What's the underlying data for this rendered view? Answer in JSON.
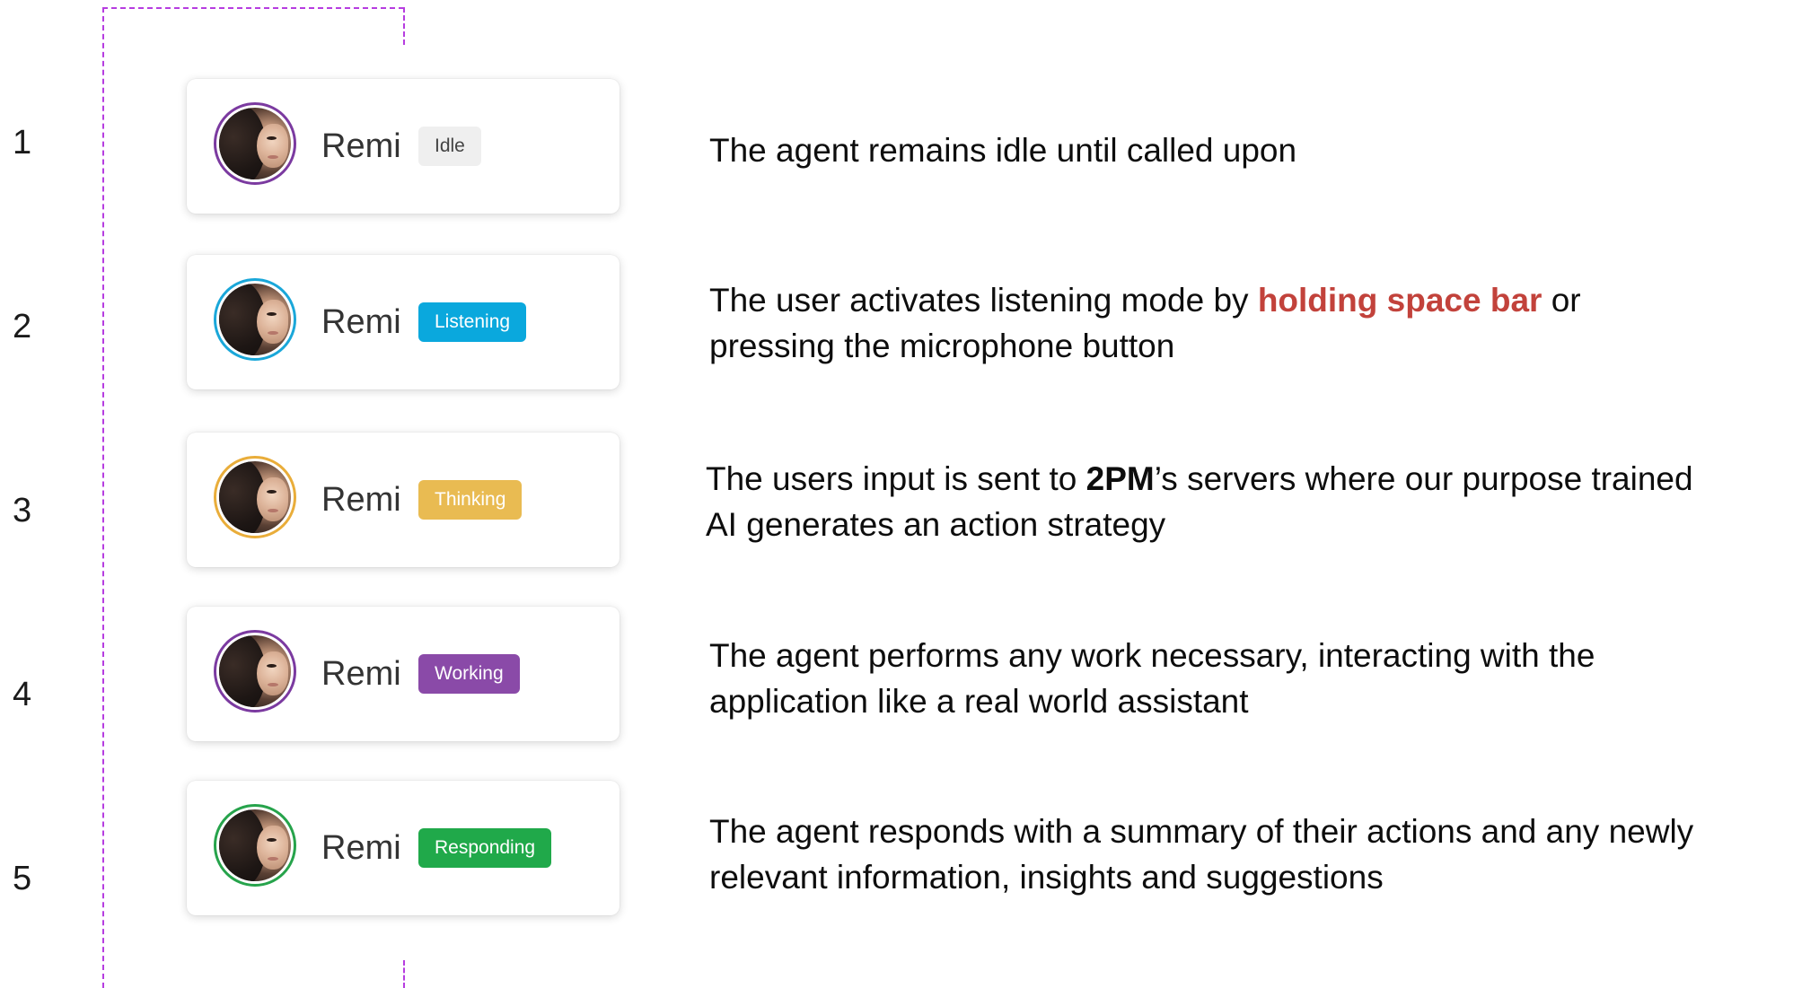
{
  "steps": [
    {
      "number": "1",
      "agent_name": "Remi",
      "status": "Idle",
      "status_color": "#efefef",
      "status_text_color": "#444444",
      "ring_color": "#7b3aa0",
      "description": "The agent remains idle until called upon"
    },
    {
      "number": "2",
      "agent_name": "Remi",
      "status": "Listening",
      "status_color": "#0aa8dd",
      "status_text_color": "#ffffff",
      "ring_color": "#1aa7d9",
      "description_before": "The user activates listening mode by ",
      "description_highlight": "holding space bar",
      "description_after": " or",
      "description_line2": "pressing the microphone button"
    },
    {
      "number": "3",
      "agent_name": "Remi",
      "status": "Thinking",
      "status_color": "#e9bb52",
      "status_text_color": "#ffffff",
      "ring_color": "#e9ad3a",
      "description_before": "The users input is sent to ",
      "description_brand": "2PM",
      "description_after": "’s servers where our purpose trained",
      "description_line2": "AI generates an action strategy"
    },
    {
      "number": "4",
      "agent_name": "Remi",
      "status": "Working",
      "status_color": "#8a4aa8",
      "status_text_color": "#ffffff",
      "ring_color": "#7b3aa0",
      "description_line1": "The agent performs any work necessary, interacting with the",
      "description_line2": "application like a real world assistant"
    },
    {
      "number": "5",
      "agent_name": "Remi",
      "status": "Responding",
      "status_color": "#20a94a",
      "status_text_color": "#ffffff",
      "ring_color": "#26a34b",
      "description_line1": "The agent responds with a summary of their actions and any newly",
      "description_line2": "relevant information, insights and suggestions"
    }
  ],
  "colors": {
    "bracket": "#b63de0",
    "highlight": "#c2423b"
  }
}
